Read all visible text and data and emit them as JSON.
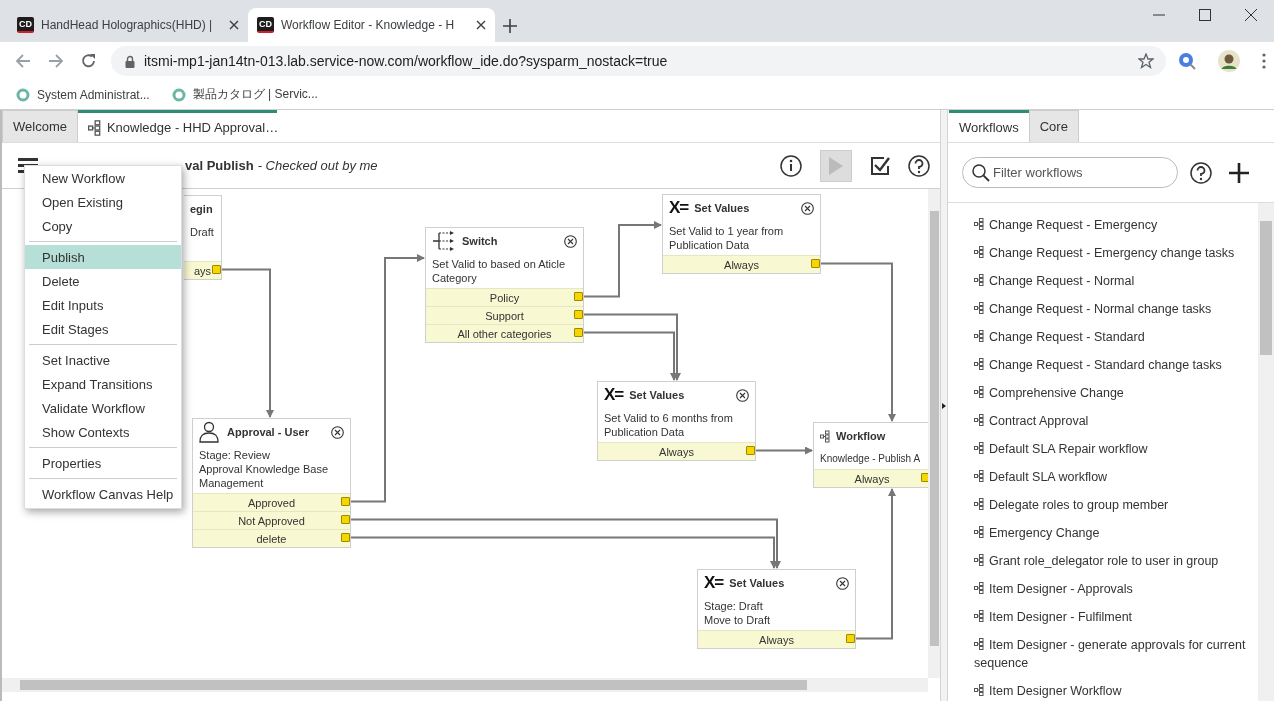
{
  "browser": {
    "tabs": [
      {
        "icon_text": "CD",
        "title": "HandHead Holographics(HHD) |",
        "selected": false
      },
      {
        "icon_text": "CD",
        "title": "Workflow Editor - Knowledge - H",
        "selected": true
      }
    ],
    "url": "itsmi-mp1-jan14tn-013.lab.service-now.com/workflow_ide.do?sysparm_nostack=true",
    "bookmarks": [
      "System Administrat...",
      "製品カタログ | Servic..."
    ]
  },
  "editor": {
    "tabs": [
      {
        "label": "Welcome",
        "selected": false
      },
      {
        "label": "Knowledge - HHD Approval…",
        "selected": true
      }
    ],
    "title": "val Publish",
    "status": "- Checked out by me",
    "run_button": {
      "disabled": true
    },
    "nodes": [
      {
        "kind": "begin",
        "title": "egin",
        "description": [
          "Draft"
        ],
        "conditions": [
          "ays"
        ]
      },
      {
        "kind": "switch",
        "title": "Switch",
        "description": [
          "Set Valid to based on Aticle",
          "Category"
        ],
        "conditions": [
          "Policy",
          "Support",
          "All other categories"
        ]
      },
      {
        "kind": "set_values",
        "icon_text": "X=",
        "title": "Set Values",
        "description": [
          "Set Valid to 1 year from",
          "Publication Data"
        ],
        "conditions": [
          "Always"
        ]
      },
      {
        "kind": "set_values",
        "icon_text": "X=",
        "title": "Set Values",
        "description": [
          "Set Valid to 6 months from",
          "Publication Data"
        ],
        "conditions": [
          "Always"
        ]
      },
      {
        "kind": "approval",
        "title": "Approval - User",
        "description": [
          "Stage: Review",
          "Approval Knowledge Base",
          "Management"
        ],
        "conditions": [
          "Approved",
          "Not Approved",
          "delete"
        ]
      },
      {
        "kind": "workflow",
        "title": "Workflow",
        "description": [
          "Knowledge - Publish A"
        ],
        "conditions": [
          "Always"
        ]
      },
      {
        "kind": "set_values",
        "icon_text": "X=",
        "title": "Set Values",
        "description": [
          "Stage: Draft",
          "Move to Draft"
        ],
        "conditions": [
          "Always"
        ]
      }
    ],
    "menu": {
      "groups": [
        [
          {
            "label": "New Workflow",
            "selected": false
          },
          {
            "label": "Open Existing",
            "selected": false
          },
          {
            "label": "Copy",
            "selected": false
          }
        ],
        [
          {
            "label": "Publish",
            "selected": true
          },
          {
            "label": "Delete",
            "selected": false
          },
          {
            "label": "Edit Inputs",
            "selected": false
          },
          {
            "label": "Edit Stages",
            "selected": false
          }
        ],
        [
          {
            "label": "Set Inactive",
            "selected": false
          },
          {
            "label": "Expand Transitions",
            "selected": false
          },
          {
            "label": "Validate Workflow",
            "selected": false
          },
          {
            "label": "Show Contexts",
            "selected": false
          }
        ],
        [
          {
            "label": "Properties",
            "selected": false
          }
        ],
        [
          {
            "label": "Workflow Canvas Help",
            "selected": false
          }
        ]
      ]
    }
  },
  "sidebar": {
    "tabs": [
      {
        "label": "Workflows",
        "selected": true
      },
      {
        "label": "Core",
        "selected": false
      }
    ],
    "filter": {
      "placeholder": "Filter workflows"
    },
    "items": [
      "Change Request - Emergency",
      "Change Request - Emergency change tasks",
      "Change Request - Normal",
      "Change Request - Normal change tasks",
      "Change Request - Standard",
      "Change Request - Standard change tasks",
      "Comprehensive Change",
      "Contract Approval",
      "Default SLA Repair workflow",
      "Default SLA workflow",
      "Delegate roles to group member",
      "Emergency Change",
      "Grant role_delegator role to user in group",
      "Item Designer - Approvals",
      "Item Designer - Fulfilment",
      "Item Designer - generate approvals for current sequence",
      "Item Designer Workflow"
    ]
  }
}
